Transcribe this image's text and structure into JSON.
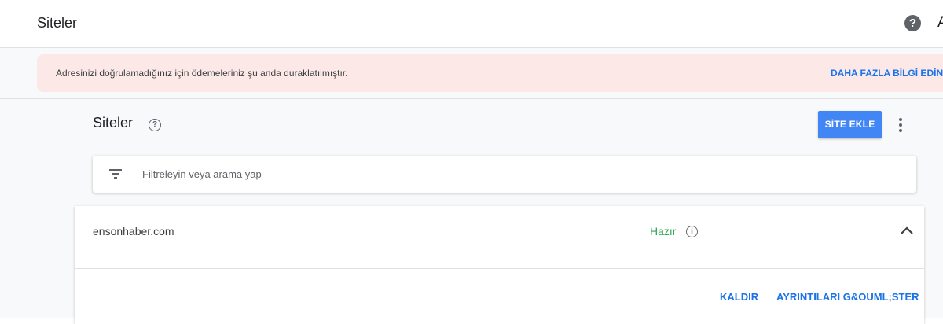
{
  "topbar": {
    "title": "Siteler",
    "help_glyph": "?",
    "avatar_initial": "A",
    "icons": [
      "help-icon"
    ]
  },
  "banner": {
    "message": "Adresinizi doğrulamadığınız için ödemeleriniz şu anda duraklatılmıştır.",
    "link_label": "DAHA FAZLA BİLGİ EDİN"
  },
  "page": {
    "heading": "Siteler",
    "help_glyph": "?",
    "add_site_label": "SİTE EKLE",
    "more_icon": "more-vert-icon"
  },
  "filter": {
    "placeholder": "Filtreleyin veya arama yap",
    "icon": "filter-list-icon"
  },
  "sites": [
    {
      "domain": "ensonhaber.com",
      "status": "Hazır",
      "status_info_glyph": "i",
      "remove_label": "KALDIR",
      "details_label": "AYRINTILARI G&OUML;STER"
    }
  ],
  "colors": {
    "accent": "#4285f4",
    "link": "#1a73e8",
    "status_ready": "#34a853",
    "banner_bg": "#fce8e6"
  }
}
